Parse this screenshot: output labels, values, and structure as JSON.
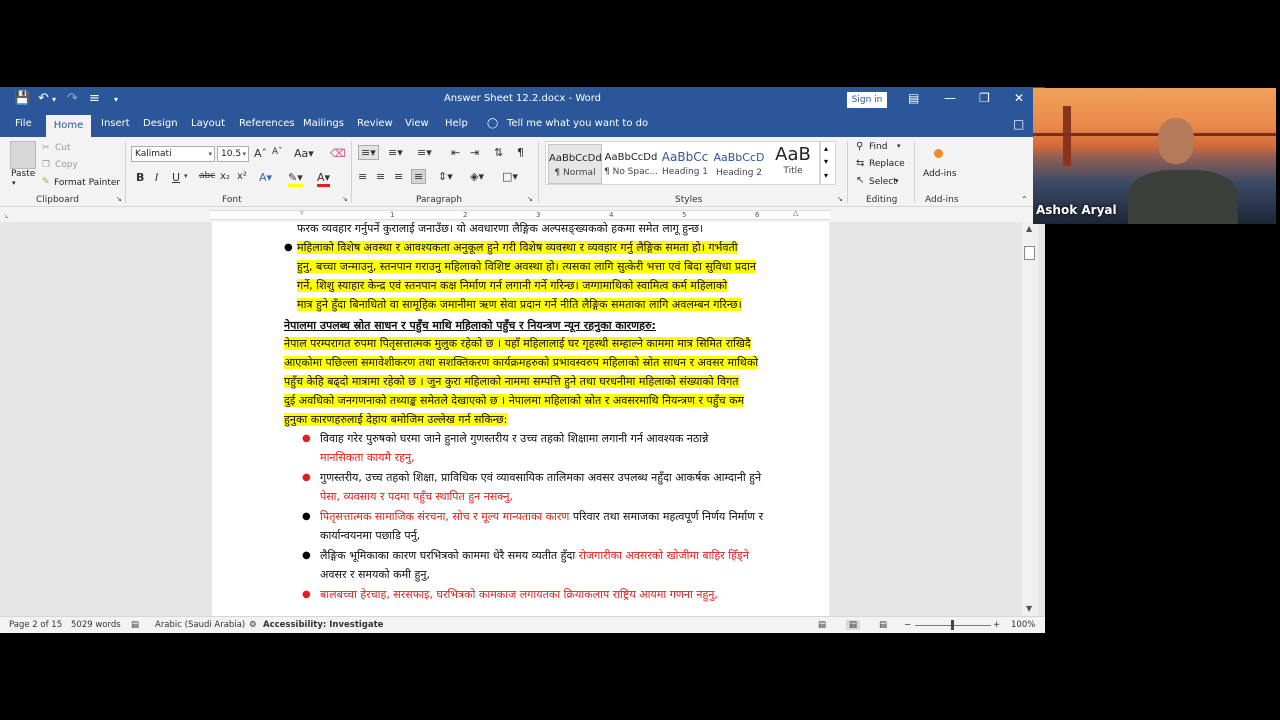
{
  "window": {
    "title": "Answer Sheet 12.2.docx  -  Word",
    "sign_in": "Sign in"
  },
  "tabs": [
    "File",
    "Home",
    "Insert",
    "Design",
    "Layout",
    "References",
    "Mailings",
    "Review",
    "View",
    "Help"
  ],
  "tell_me": "Tell me what you want to do",
  "ribbon": {
    "clipboard": {
      "paste": "Paste",
      "cut": "Cut",
      "copy": "Copy",
      "format_painter": "Format Painter",
      "label": "Clipboard"
    },
    "font": {
      "name": "Kalimati",
      "size": "10.5",
      "label": "Font"
    },
    "paragraph": {
      "label": "Paragraph"
    },
    "styles": {
      "label": "Styles",
      "items": [
        {
          "sample": "AaBbCcDd",
          "name": "¶ Normal"
        },
        {
          "sample": "AaBbCcDd",
          "name": "¶ No Spac..."
        },
        {
          "sample": "AaBbCc",
          "name": "Heading 1"
        },
        {
          "sample": "AaBbCcD",
          "name": "Heading 2"
        },
        {
          "sample": "AaB",
          "name": "Title"
        }
      ]
    },
    "editing": {
      "find": "Find",
      "replace": "Replace",
      "select": "Select",
      "label": "Editing"
    },
    "addins": {
      "button": "Add-ins",
      "label": "Add-ins"
    }
  },
  "ruler": [
    "1",
    "2",
    "3",
    "4",
    "5",
    "6",
    "7"
  ],
  "document": {
    "line0": "फरक व्यवहार गर्नुपर्ने कुरालाई जनाउँछ। यो अवधारणा लैङ्गिक अल्पसङ्ख्यकको हकमा समेत लागू हुन्छ।",
    "p1": [
      "महिलाको विशेष अवस्था र आवश्यकता अनुकूल हुने गरी विशेष व्यवस्था र व्यवहार गर्नु लैङ्गिक समता हो। गर्भवती",
      "हुनु, बच्चा जन्माउनु, स्तनपान गराउनु महिलाको विशिष्ट अवस्था हो। त्यसका लागि सुत्केरी भत्ता एवं बिदा सुविधा प्रदान",
      "गर्ने, शिशु स्याहार केन्द्र एवं स्तनपान कक्ष निर्माण गर्न लगानी गर्ने गरिन्छ। जग्गामाथिको स्वामित्व कर्म महिलाको",
      "मात्र हुने हुँदा बिनाधितो वा सामूहिक जमानीमा ऋण सेवा प्रदान गर्ने नीति लैङ्गिक समताका लागि अवलम्बन गरिन्छ।"
    ],
    "heading": "नेपालमा उपलब्ध स्रोत साधन र पहुँच माथि महिलाको पहुँच र नियन्त्रण न्यून रहनुका कारणहरु:",
    "p2": [
      "नेपाल परम्परागत रुपमा पितृसत्तात्मक मुलुक रहेको छ । यहाँ महिलालाई घर गृहस्थी सम्हाल्ने काममा मात्र सिमित राखिदै",
      "आएकोमा पछिल्ला समावेशीकरण तथा सशक्तिकरण कार्यक्रमहरुको प्रभावस्वरुप महिलाको स्रोत साधन र अवसर माथिको",
      "पहुँच केहि बढ्दो मात्रामा रहेको छ । जुन कुरा महिलाको नाममा सम्पत्ति हुने तथा घरधनीमा महिलाको संख्याको विगत",
      "दुई अवधिको जनगणनाको तथ्याङ्क समेतले देखाएको छ । नेपालमा महिलाको स्रोत र अवसरमाथि नियन्त्रण र पहुँच कम",
      "हुनुका कारणहरुलाई देहाय बमोजिम उल्लेख गर्न सकिन्छ:"
    ],
    "b1": [
      "विवाह गरेर पुरुषको घरमा जाने हुनाले गुणस्तरीय र उच्च तहको शिक्षामा लगानी गर्न आवश्यक नठान्ने",
      "मानसिकता कायमै रहनु,"
    ],
    "b2": [
      "गुणस्तरीय, उच्च तहको शिक्षा, प्राविधिक एवं व्यावसायिक तालिमका अवसर उपलब्ध नहुँदा आकर्षक आम्दानी हुने",
      "पेसा, व्यवसाय र पदमा पहुँच स्थापित हुन नसक्नु,"
    ],
    "b3": [
      "पितृसत्तात्मक सामाजिक संरचना, सोच र मूल्य मान्यताका कारण",
      " परिवार तथा समाजका महत्वपूर्ण निर्णय निर्माण र",
      "कार्यान्वयनमा पछाडि पर्नु,"
    ],
    "b4": [
      "लैङ्गिक भूमिकाका कारण घरभित्रको काममा धेरै समय व्यतीत हुँदा ",
      "रोजगारीका अवसरको खोजीमा बाहिर हिँड्ने",
      "अवसर र समयको कमी हुनु,"
    ],
    "b5": "बालबच्चा हेरचाह, सरसफाइ, घरभित्रको कामकाज लगायतका क्रियाकलाप राष्ट्रिय आयमा गणना नहुनु,"
  },
  "status": {
    "page": "Page 2 of 15",
    "words": "5029 words",
    "language": "Arabic (Saudi Arabia)",
    "accessibility": "Accessibility: Investigate",
    "zoom": "100%"
  },
  "webcam": {
    "name": "Ashok Aryal"
  },
  "colors": {
    "titlebar": "#2b579a",
    "highlight": "#ffff00",
    "red_text": "#e02020"
  }
}
